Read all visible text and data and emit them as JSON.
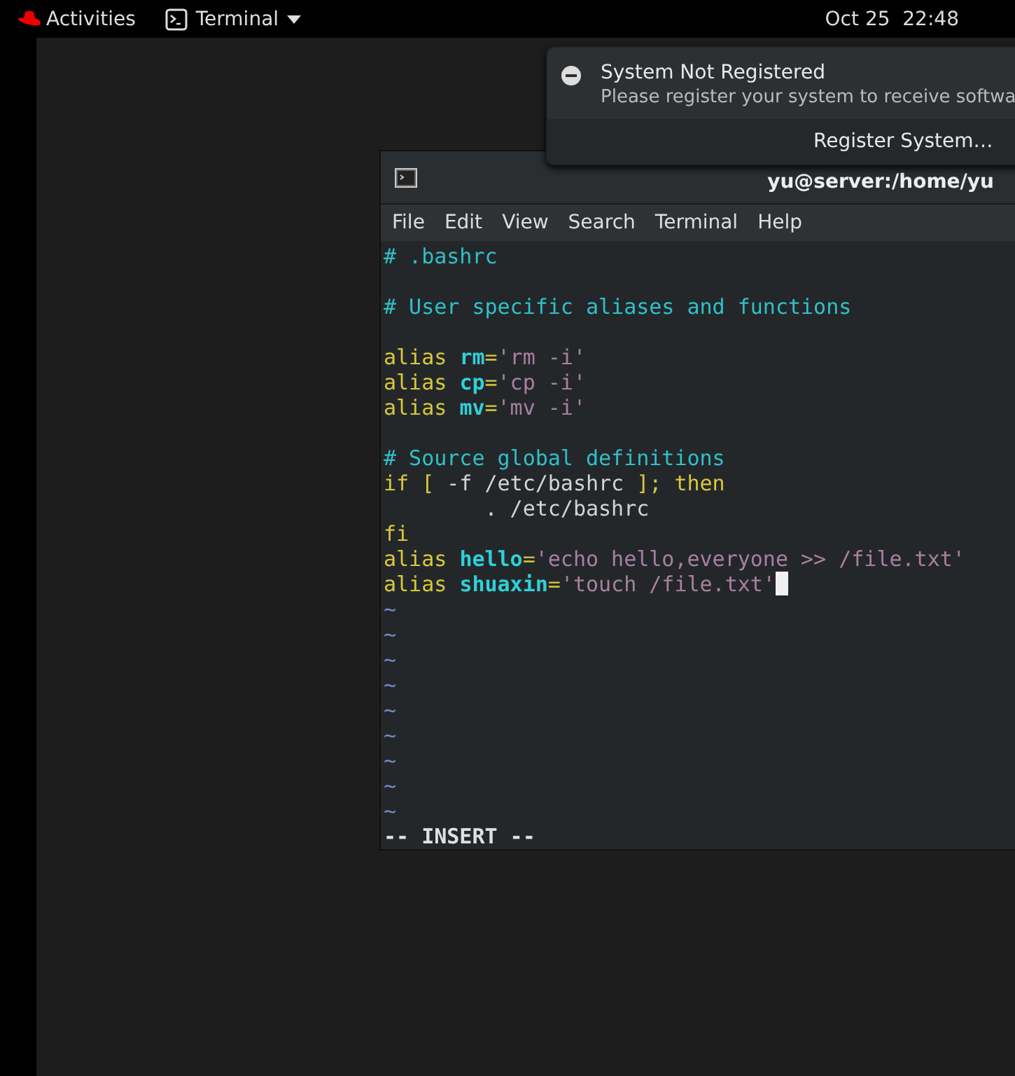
{
  "top_bar": {
    "activities": "Activities",
    "app_menu": "Terminal",
    "clock": "Oct 25  22:48"
  },
  "notification": {
    "title": "System Not Registered",
    "body": "Please register your system to receive softwa",
    "action": "Register System…"
  },
  "terminal": {
    "title": "yu@server:/home/yu",
    "menu": [
      "File",
      "Edit",
      "View",
      "Search",
      "Terminal",
      "Help"
    ],
    "lines": [
      {
        "segments": [
          {
            "kind": "comment",
            "text": "# .bashrc"
          }
        ]
      },
      {
        "kind": "blank"
      },
      {
        "segments": [
          {
            "kind": "comment",
            "text": "# User specific aliases and functions"
          }
        ]
      },
      {
        "kind": "blank"
      },
      {
        "segments": [
          {
            "kind": "keyword",
            "text": "alias "
          },
          {
            "kind": "name",
            "text": "rm"
          },
          {
            "kind": "keyword",
            "text": "="
          },
          {
            "kind": "string",
            "text": "'rm -i'"
          }
        ]
      },
      {
        "segments": [
          {
            "kind": "keyword",
            "text": "alias "
          },
          {
            "kind": "name",
            "text": "cp"
          },
          {
            "kind": "keyword",
            "text": "="
          },
          {
            "kind": "string",
            "text": "'cp -i'"
          }
        ]
      },
      {
        "segments": [
          {
            "kind": "keyword",
            "text": "alias "
          },
          {
            "kind": "name",
            "text": "mv"
          },
          {
            "kind": "keyword",
            "text": "="
          },
          {
            "kind": "string",
            "text": "'mv -i'"
          }
        ]
      },
      {
        "kind": "blank"
      },
      {
        "segments": [
          {
            "kind": "comment",
            "text": "# Source global definitions"
          }
        ]
      },
      {
        "segments": [
          {
            "kind": "keyword",
            "text": "if [ "
          },
          {
            "kind": "plain",
            "text": "-f /etc/bashrc "
          },
          {
            "kind": "keyword",
            "text": "]; then"
          }
        ]
      },
      {
        "segments": [
          {
            "kind": "plain",
            "text": "        . /etc/bashrc"
          }
        ]
      },
      {
        "segments": [
          {
            "kind": "keyword",
            "text": "fi"
          }
        ]
      },
      {
        "segments": [
          {
            "kind": "keyword",
            "text": "alias "
          },
          {
            "kind": "name",
            "text": "hello"
          },
          {
            "kind": "keyword",
            "text": "="
          },
          {
            "kind": "string",
            "text": "'echo hello,everyone >> /file.txt'"
          }
        ]
      },
      {
        "segments": [
          {
            "kind": "keyword",
            "text": "alias "
          },
          {
            "kind": "name",
            "text": "shuaxin"
          },
          {
            "kind": "keyword",
            "text": "="
          },
          {
            "kind": "string",
            "text": "'touch /file.txt'"
          }
        ],
        "cursor": true
      },
      {
        "segments": [
          {
            "kind": "tilde",
            "text": "~"
          }
        ]
      },
      {
        "segments": [
          {
            "kind": "tilde",
            "text": "~"
          }
        ]
      },
      {
        "segments": [
          {
            "kind": "tilde",
            "text": "~"
          }
        ]
      },
      {
        "segments": [
          {
            "kind": "tilde",
            "text": "~"
          }
        ]
      },
      {
        "segments": [
          {
            "kind": "tilde",
            "text": "~"
          }
        ]
      },
      {
        "segments": [
          {
            "kind": "tilde",
            "text": "~"
          }
        ]
      },
      {
        "segments": [
          {
            "kind": "tilde",
            "text": "~"
          }
        ]
      },
      {
        "segments": [
          {
            "kind": "tilde",
            "text": "~"
          }
        ]
      },
      {
        "segments": [
          {
            "kind": "tilde",
            "text": "~"
          }
        ]
      }
    ],
    "mode": "-- INSERT --"
  }
}
